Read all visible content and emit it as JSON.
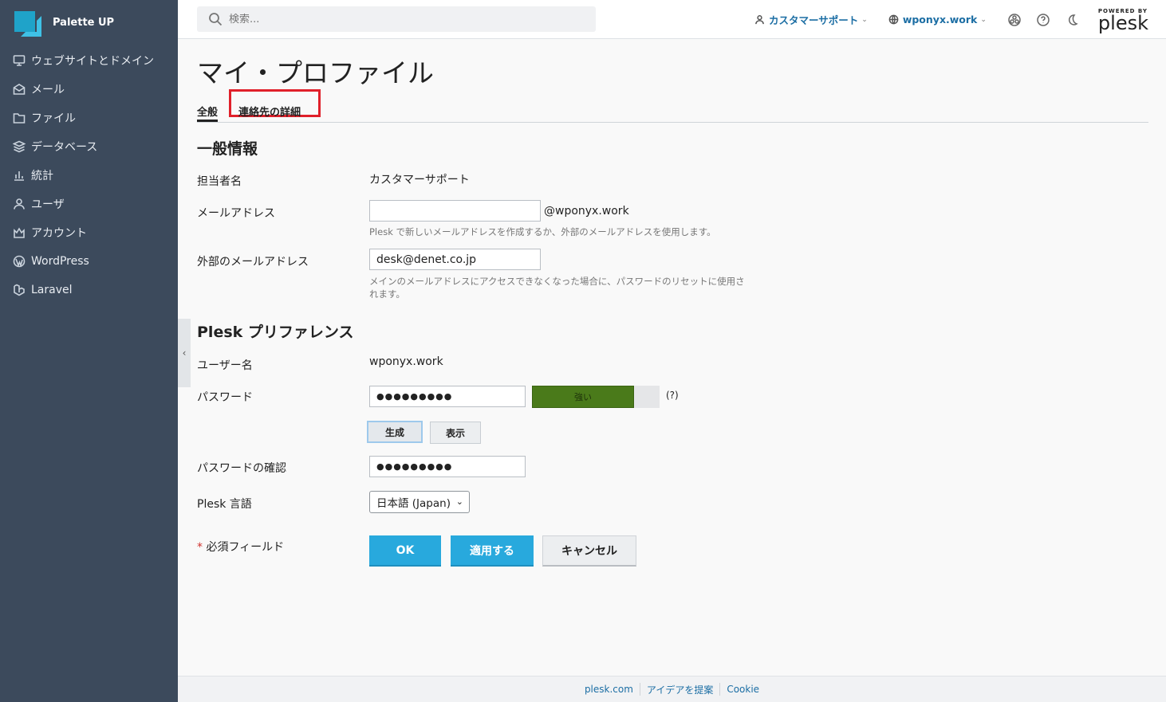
{
  "brand": {
    "name": "Palette UP"
  },
  "sidebar": {
    "items": [
      {
        "label": "ウェブサイトとドメイン",
        "icon": "monitor-icon"
      },
      {
        "label": "メール",
        "icon": "mail-icon"
      },
      {
        "label": "ファイル",
        "icon": "folder-icon"
      },
      {
        "label": "データベース",
        "icon": "database-icon"
      },
      {
        "label": "統計",
        "icon": "chart-icon"
      },
      {
        "label": "ユーザ",
        "icon": "user-icon"
      },
      {
        "label": "アカウント",
        "icon": "crown-icon"
      },
      {
        "label": "WordPress",
        "icon": "wordpress-icon"
      },
      {
        "label": "Laravel",
        "icon": "laravel-icon"
      }
    ]
  },
  "topbar": {
    "search_placeholder": "検索...",
    "user_menu": "カスタマーサポート",
    "domain_menu": "wponyx.work",
    "logo_powered": "POWERED BY",
    "logo_name": "plesk"
  },
  "page": {
    "title": "マイ・プロファイル",
    "tabs": [
      "全般",
      "連絡先の詳細"
    ]
  },
  "general": {
    "title": "一般情報",
    "contact_label": "担当者名",
    "contact_value": "カスタマーサポート",
    "email_label": "メールアドレス",
    "email_value": "",
    "email_suffix": "@wponyx.work",
    "email_hint": "Plesk で新しいメールアドレスを作成するか、外部のメールアドレスを使用します。",
    "ext_email_label": "外部のメールアドレス",
    "ext_email_value": "desk@denet.co.jp",
    "ext_email_hint_1": "メインのメールアドレスにアクセスできなくなった場合に、パスワードのリセットに使用さ",
    "ext_email_hint_2": "れます。"
  },
  "prefs": {
    "title": "Plesk プリファレンス",
    "username_label": "ユーザー名",
    "username_value": "wponyx.work",
    "password_label": "パスワード",
    "password_value": "●●●●●●●●●",
    "strength_label": "強い",
    "strength_level": 0.8,
    "help": "(?)",
    "generate": "生成",
    "show": "表示",
    "confirm_label": "パスワードの確認",
    "confirm_value": "●●●●●●●●●",
    "lang_label": "Plesk 言語",
    "lang_value": "日本語 (Japan)"
  },
  "form": {
    "required_mark": "*",
    "required_label": "必須フィールド",
    "ok": "OK",
    "apply": "適用する",
    "cancel": "キャンセル"
  },
  "footer": {
    "links": [
      "plesk.com",
      "アイデアを提案",
      "Cookie"
    ]
  }
}
